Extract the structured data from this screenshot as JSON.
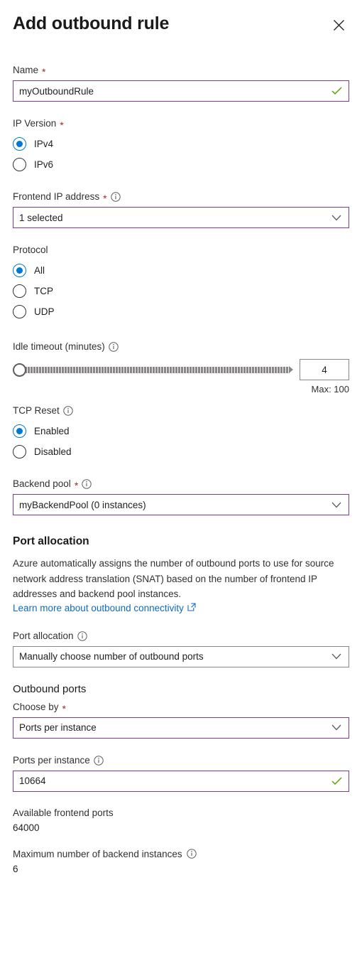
{
  "header": {
    "title": "Add outbound rule",
    "close_icon": "close-icon"
  },
  "name_field": {
    "label": "Name",
    "required_mark": "*",
    "value": "myOutboundRule",
    "placeholder": "",
    "valid_icon": "checkmark-icon"
  },
  "ip_version": {
    "label": "IP Version",
    "required_mark": "*",
    "options": [
      {
        "label": "IPv4",
        "selected": true
      },
      {
        "label": "IPv6",
        "selected": false
      }
    ]
  },
  "frontend_ip": {
    "label": "Frontend IP address",
    "required_mark": "*",
    "info_icon": "info-icon",
    "value": "1 selected",
    "chevron_icon": "chevron-down-icon"
  },
  "protocol": {
    "label": "Protocol",
    "options": [
      {
        "label": "All",
        "selected": true
      },
      {
        "label": "TCP",
        "selected": false
      },
      {
        "label": "UDP",
        "selected": false
      }
    ]
  },
  "idle_timeout": {
    "label": "Idle timeout (minutes)",
    "info_icon": "info-icon",
    "value": "4",
    "max_note": "Max: 100",
    "min": 4,
    "max": 100
  },
  "tcp_reset": {
    "label": "TCP Reset",
    "info_icon": "info-icon",
    "options": [
      {
        "label": "Enabled",
        "selected": true
      },
      {
        "label": "Disabled",
        "selected": false
      }
    ]
  },
  "backend_pool": {
    "label": "Backend pool",
    "required_mark": "*",
    "info_icon": "info-icon",
    "value": "myBackendPool (0 instances)",
    "chevron_icon": "chevron-down-icon"
  },
  "port_allocation_section": {
    "heading": "Port allocation",
    "description": "Azure automatically assigns the number of outbound ports to use for source network address translation (SNAT) based on the number of frontend IP addresses and backend pool instances.",
    "link_text": "Learn more about outbound connectivity",
    "link_icon": "external-link-icon"
  },
  "port_allocation": {
    "label": "Port allocation",
    "info_icon": "info-icon",
    "value": "Manually choose number of outbound ports",
    "chevron_icon": "chevron-down-icon"
  },
  "outbound_ports": {
    "heading": "Outbound ports",
    "choose_by": {
      "label": "Choose by",
      "required_mark": "*",
      "value": "Ports per instance",
      "chevron_icon": "chevron-down-icon"
    },
    "ports_per_instance": {
      "label": "Ports per instance",
      "info_icon": "info-icon",
      "value": "10664",
      "valid_icon": "checkmark-icon"
    },
    "available_frontend_ports": {
      "label": "Available frontend ports",
      "value": "64000"
    },
    "max_backend_instances": {
      "label": "Maximum number of backend instances",
      "info_icon": "info-icon",
      "value": "6"
    }
  },
  "colors": {
    "accent_blue": "#0078d4",
    "link_blue": "#0f6cbd",
    "required_red": "#a4262c",
    "valid_green": "#5ba300",
    "focus_purple": "#7d3c98",
    "neutral_border": "#8a8886"
  }
}
